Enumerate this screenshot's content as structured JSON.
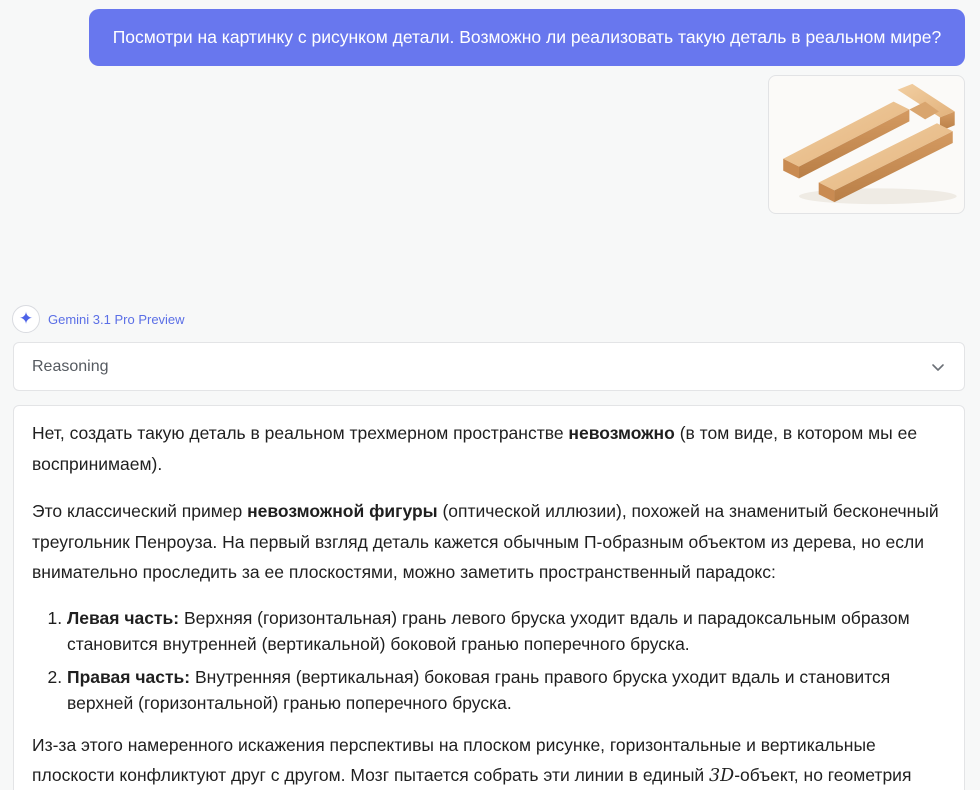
{
  "user_message": {
    "text": "Посмотри на картинку с рисунком детали. Возможно ли реализовать такую деталь в реальном мире?"
  },
  "attachment": {
    "icon": "image-thumbnail-wooden-u-shape"
  },
  "model": {
    "name": "Gemini 3.1 Pro Preview",
    "icon": "sparkle-icon"
  },
  "reasoning": {
    "label": "Reasoning",
    "icon": "chevron-down-icon"
  },
  "answer": {
    "p1": {
      "before": "Нет, создать такую деталь в реальном трехмерном пространстве ",
      "bold": "невозможно",
      "after": " (в том виде, в котором мы ее воспринимаем)."
    },
    "p2": {
      "before": "Это классический пример ",
      "bold": "невозможной фигуры",
      "after": " (оптической иллюзии), похожей на знаменитый бесконечный треугольник Пенроуза. На первый взгляд деталь кажется обычным П-образным объектом из дерева, но если внимательно проследить за ее плоскостями, можно заметить пространственный парадокс:"
    },
    "list": [
      {
        "bold": "Левая часть:",
        "text": " Верхняя (горизонтальная) грань левого бруска уходит вдаль и парадоксальным образом становится внутренней (вертикальной) боковой гранью поперечного бруска."
      },
      {
        "bold": "Правая часть:",
        "text": " Внутренняя (вертикальная) боковая грань правого бруска уходит вдаль и становится верхней (горизонтальной) гранью поперечного бруска."
      }
    ],
    "p3": {
      "before": "Из-за этого намеренного искажения перспективы на плоском рисунке, горизонтальные и вертикальные плоскости конфликтуют друг с другом. Мозг пытается собрать эти линии в единый ",
      "math": "3D",
      "after": "-объект, но геометрия"
    }
  }
}
